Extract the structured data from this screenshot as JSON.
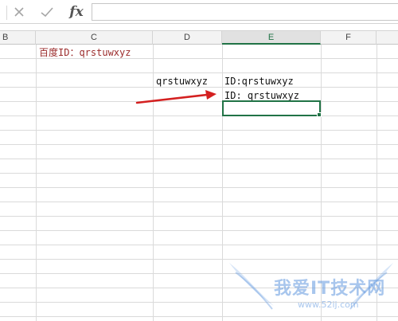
{
  "formula_bar": {
    "cancel_icon": "close-icon",
    "enter_icon": "check-icon",
    "fx_label": "fx",
    "formula_value": ""
  },
  "columns": [
    "B",
    "C",
    "D",
    "E",
    "F"
  ],
  "selected_column": "E",
  "cells": {
    "c1": "百度ID：qrstuwxyz",
    "d3": "qrstuwxyz",
    "e3": "ID:qrstuwxyz",
    "e4": "ID: qrstuwxyz"
  },
  "watermark": {
    "title": "我爱IT技术网",
    "url": "www.52ij.com"
  },
  "colors": {
    "accent": "#217346",
    "arrow": "#d42020",
    "red_text": "#9b2c2c",
    "watermark": "#6ea0e1"
  }
}
